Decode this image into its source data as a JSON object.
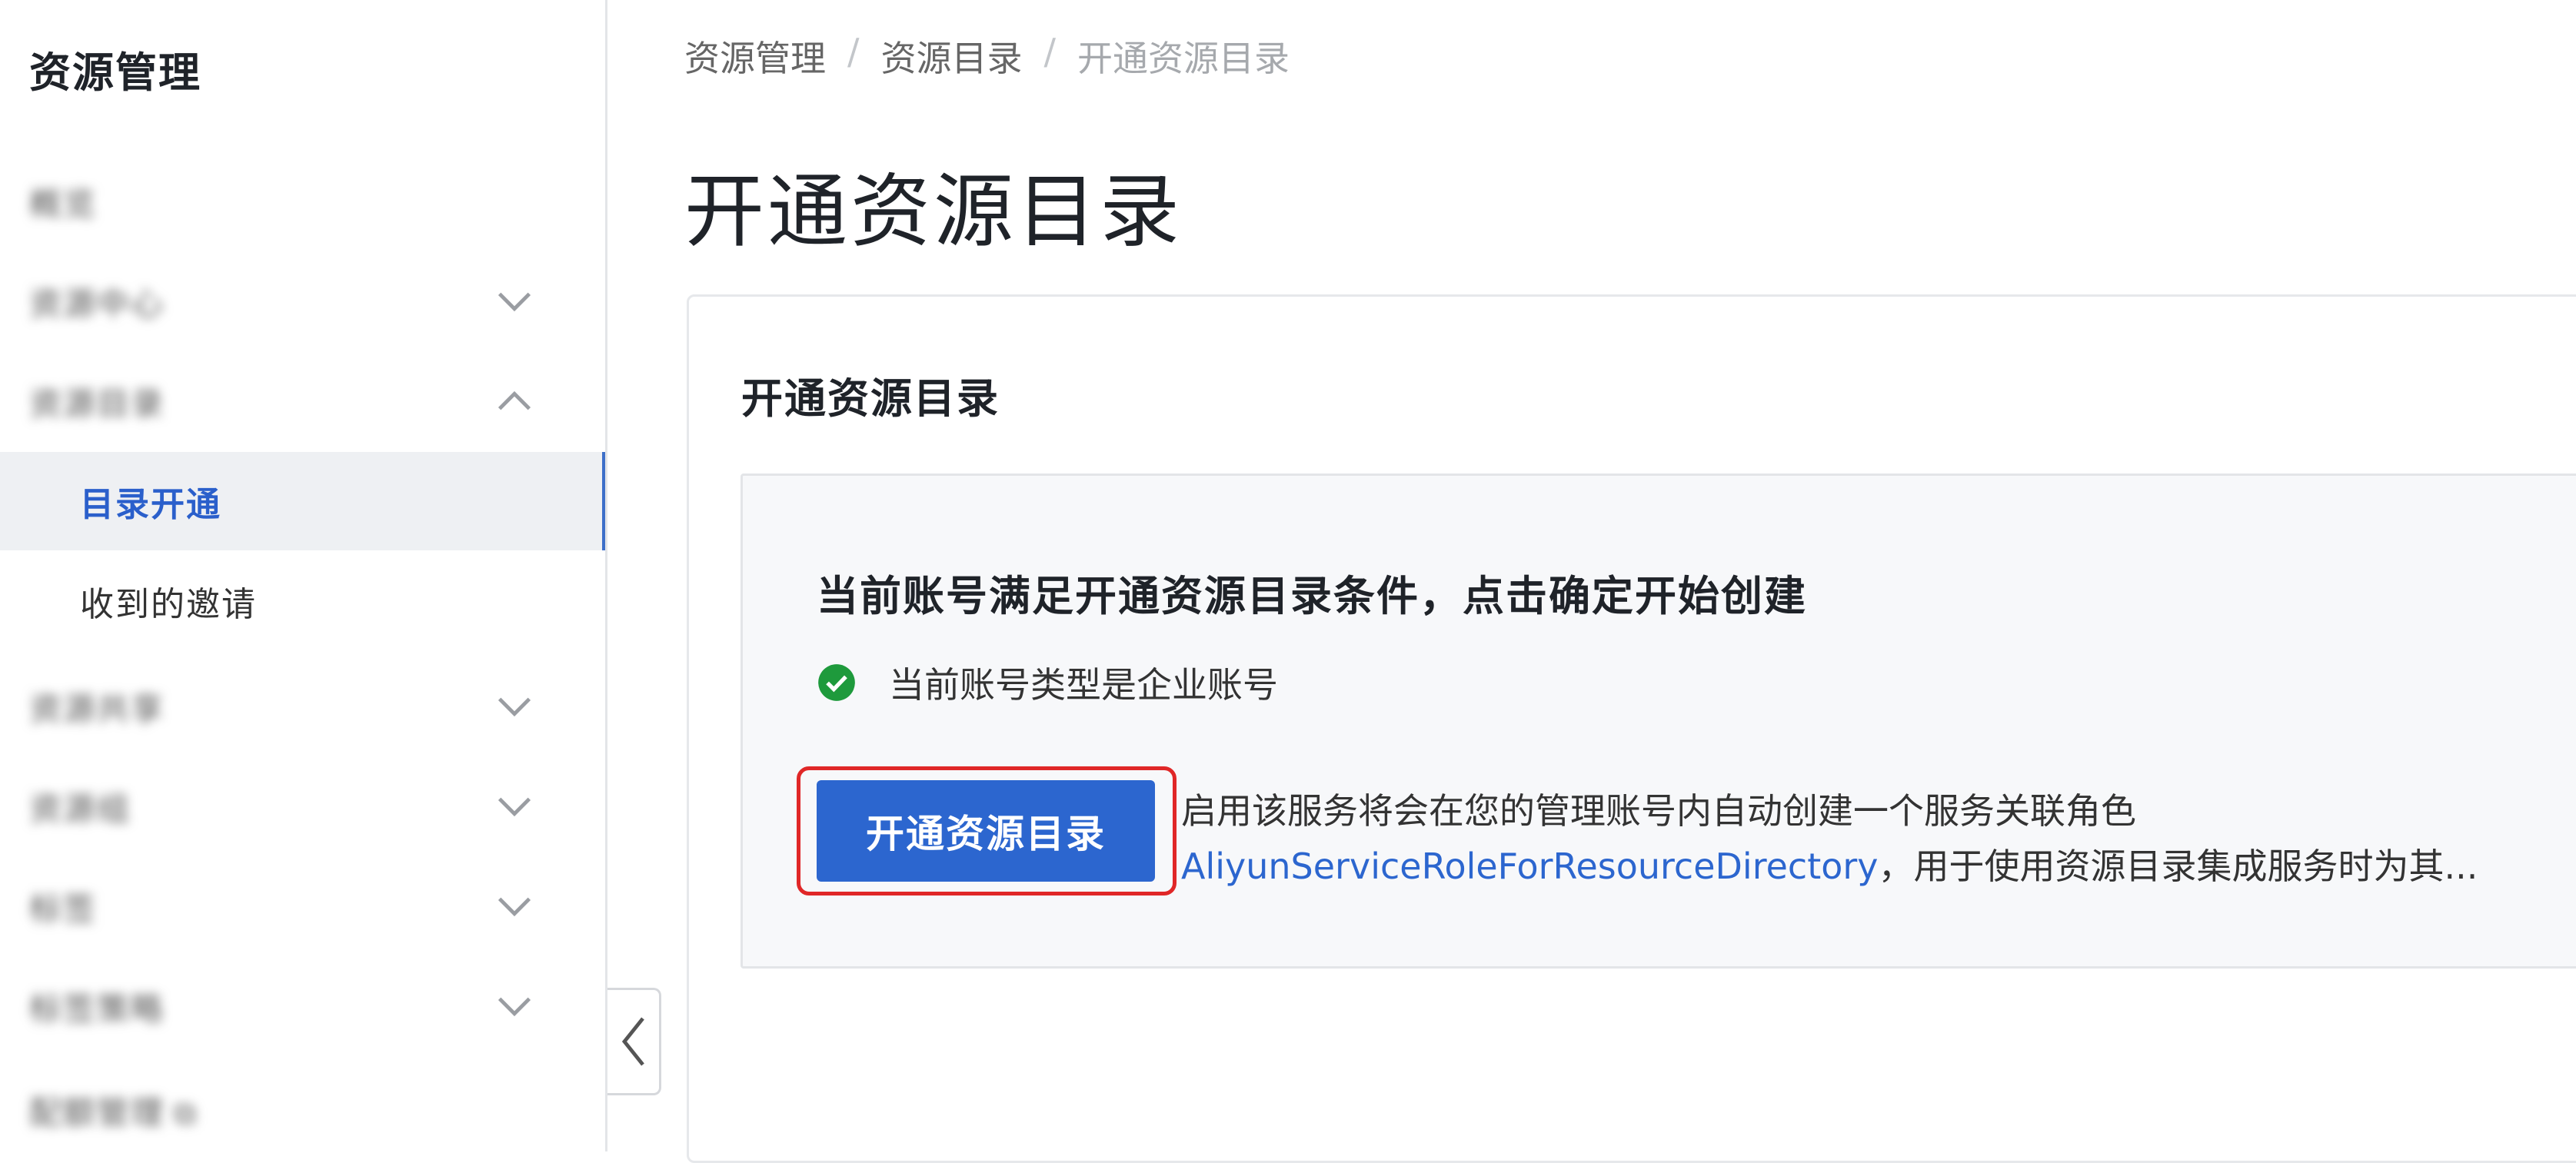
{
  "sidebar": {
    "title": "资源管理",
    "items": [
      {
        "label": "概览",
        "chevron": "none"
      },
      {
        "label": "资源中心",
        "chevron": "down"
      },
      {
        "label": "资源目录",
        "chevron": "up"
      },
      {
        "label": "目录开通",
        "sub": true,
        "active": true
      },
      {
        "label": "收到的邀请",
        "sub": true
      },
      {
        "label": "资源共享",
        "chevron": "down"
      },
      {
        "label": "资源组",
        "chevron": "down"
      },
      {
        "label": "标签",
        "chevron": "down"
      },
      {
        "label": "标签策略",
        "chevron": "down"
      },
      {
        "label": "配额管理",
        "external_icon": "external-link-icon"
      }
    ],
    "collapse_icon": "chevron-left-icon"
  },
  "breadcrumb": {
    "items": [
      "资源管理",
      "资源目录",
      "开通资源目录"
    ],
    "separator": "/"
  },
  "page": {
    "title": "开通资源目录"
  },
  "card": {
    "title": "开通资源目录",
    "panel": {
      "heading": "当前账号满足开通资源目录条件，点击确定开始创建",
      "check_icon": "check-circle-icon",
      "check_text": "当前账号类型是企业账号",
      "button_label": "开通资源目录",
      "info_line1": "启用该服务将会在您的管理账号内自动创建一个服务关联角色",
      "info_link": "AliyunServiceRoleForResourceDirectory",
      "info_line2_rest": "，用于使用资源目录集成服务时为其..."
    }
  },
  "colors": {
    "primary": "#2c66cf",
    "highlight_border": "#e02727",
    "success": "#1e9a3c",
    "active_bg": "#eef0f3"
  }
}
